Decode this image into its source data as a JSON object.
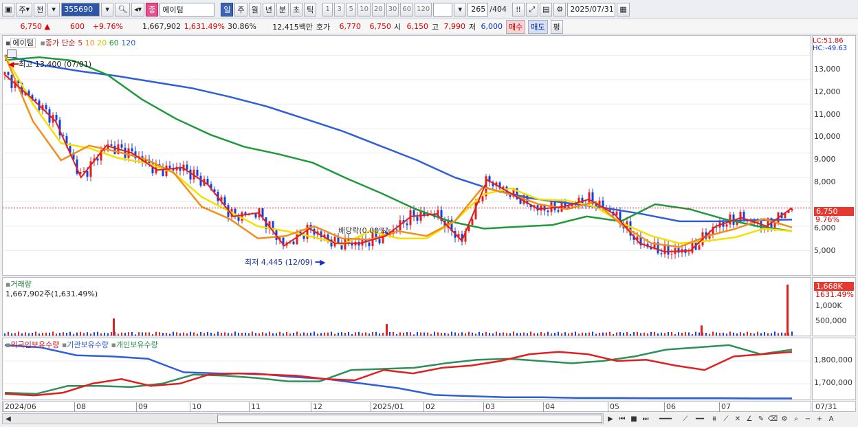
{
  "toolbar": {
    "market": "주",
    "period_prefix": "전",
    "code": "355690",
    "name": "에이텀",
    "type_badge": "종",
    "periods": [
      "일",
      "주",
      "월",
      "년",
      "분",
      "초",
      "틱"
    ],
    "intervals": [
      "1",
      "3",
      "5",
      "10",
      "20",
      "30",
      "60",
      "120"
    ],
    "count": "265",
    "total": "/404",
    "date": "2025/07/31"
  },
  "quote": {
    "price": "6,750",
    "arrow": "▲",
    "change": "600",
    "change_pct": "+9.76%",
    "volume": "1,667,902",
    "vol_pct": "1,631.49%",
    "turnover": "30.86%",
    "amount": "12,415백만",
    "hoga_label": "호가",
    "ask": "6,770",
    "bid": "6,750",
    "open_label": "시",
    "open": "6,150",
    "high_label": "고",
    "high": "7,990",
    "low_label": "저",
    "low": "6,000",
    "buy": "매수",
    "sell": "매도",
    "eval": "평"
  },
  "price_pane": {
    "name": "에이텀",
    "legend_prefix": "종가 단순",
    "ma_periods": [
      "5",
      "10",
      "20",
      "60",
      "120"
    ],
    "ma_colors": [
      "#e02020",
      "#f0901a",
      "#f5e000",
      "#1f9a3a",
      "#2f5fd8"
    ],
    "lc": "LC:51.86",
    "hc": "HC:-49.63",
    "high_note": "최고 13,400 (07/01)",
    "low_note": "최저 4,445 (12/09)",
    "div_note": "배당락(0.00%)",
    "last": "6,750",
    "last_pct": "9.76%",
    "yticks": [
      "13,000",
      "12,000",
      "11,000",
      "10,000",
      "9,000",
      "8,000",
      "7,000",
      "6,000",
      "5,000"
    ]
  },
  "volume_pane": {
    "title": "거래량",
    "value": "1,667,902주(1,631.49%)",
    "tag": "1,668K",
    "tag_pct": "1631.49%",
    "yticks": [
      "1,000K",
      "500,000"
    ]
  },
  "holdings_pane": {
    "legend": [
      "외국인보유수량",
      "기관보유수량",
      "개인보유수량"
    ],
    "colors": [
      "#e02020",
      "#2f5fd8",
      "#2e8f5a"
    ],
    "yticks": [
      "1,800,000",
      "1,700,000"
    ]
  },
  "xaxis": [
    "2024/06",
    "08",
    "09",
    "10",
    "11",
    "12",
    "2025/01",
    "02",
    "03",
    "04",
    "05",
    "06",
    "07"
  ],
  "xaxis_right": "07/31",
  "chart_data": {
    "type": "candlestick",
    "title": "",
    "price_range": [
      4000,
      13800
    ],
    "yticks_price": [
      13000,
      12000,
      11000,
      10000,
      9000,
      8000,
      7000,
      6000,
      5000
    ],
    "annotations": {
      "high": 13400,
      "high_date": "07/01",
      "low": 4445,
      "low_date": "12/09",
      "last": 6750
    },
    "ma120": [
      13000,
      12600,
      12350,
      12150,
      11900,
      11650,
      11300,
      10900,
      10400,
      9900,
      9300,
      8700,
      8000,
      7500,
      7150,
      6950,
      6750,
      6500,
      6200,
      6200,
      6250,
      6270
    ],
    "ma60": [
      12800,
      12920,
      12780,
      12200,
      11200,
      10400,
      9750,
      9250,
      8950,
      8600,
      7950,
      7350,
      6700,
      6200,
      5900,
      5980,
      6050,
      6400,
      6200,
      6900,
      6700,
      6300,
      6000,
      5800
    ],
    "ma20": [
      13000,
      11000,
      9400,
      9200,
      8800,
      8600,
      8200,
      7200,
      6600,
      6000,
      5800,
      5550,
      5250,
      5800,
      5500,
      5500,
      6200,
      7300,
      7550,
      7100,
      7050,
      6800,
      6100,
      5600,
      5300,
      5400,
      5550,
      5900,
      5800
    ],
    "ma10": [
      13000,
      10300,
      8700,
      9300,
      9050,
      8750,
      8200,
      6800,
      6300,
      5500,
      5600,
      6000,
      5500,
      5450,
      5800,
      5600,
      6200,
      7600,
      7300,
      6900,
      6700,
      7000,
      6000,
      5300,
      5150,
      5600,
      5900,
      6300,
      5950
    ],
    "close": [
      12200,
      11300,
      10300,
      8000,
      9300,
      9000,
      8300,
      8400,
      7700,
      6400,
      6550,
      5200,
      5900,
      5300,
      5300,
      5600,
      6400,
      6500,
      5400,
      7900,
      7300,
      6700,
      6800,
      7100,
      6500,
      5300,
      4950,
      5000,
      6000,
      6350,
      6000,
      6750
    ],
    "volume_range": [
      0,
      1800000
    ],
    "volume_spikes": [
      {
        "label": "08",
        "v": 560000
      },
      {
        "label": "2025/01",
        "v": 380000
      },
      {
        "label": "06",
        "v": 330000
      },
      {
        "label": "07/31",
        "v": 1667902
      }
    ],
    "holdings_range": [
      1630000,
      1900000
    ],
    "foreign": [
      1655,
      1648,
      1660,
      1700,
      1720,
      1690,
      1700,
      1740,
      1745,
      1740,
      1735,
      1720,
      1715,
      1760,
      1745,
      1770,
      1780,
      1800,
      1830,
      1840,
      1830,
      1800,
      1805,
      1780,
      1760,
      1820,
      1830,
      1840
    ],
    "institution": [
      1870,
      1860,
      1825,
      1820,
      1810,
      1750,
      1745,
      1745,
      1730,
      1720,
      1700,
      1680,
      1650,
      1645,
      1640,
      1640,
      1637,
      1637,
      1636,
      1636,
      1636,
      1635,
      1635
    ],
    "individual": [
      1660,
      1655,
      1690,
      1690,
      1685,
      1700,
      1740,
      1735,
      1725,
      1710,
      1710,
      1760,
      1765,
      1770,
      1790,
      1805,
      1810,
      1800,
      1790,
      1800,
      1820,
      1850,
      1860,
      1870,
      1830,
      1850
    ]
  }
}
